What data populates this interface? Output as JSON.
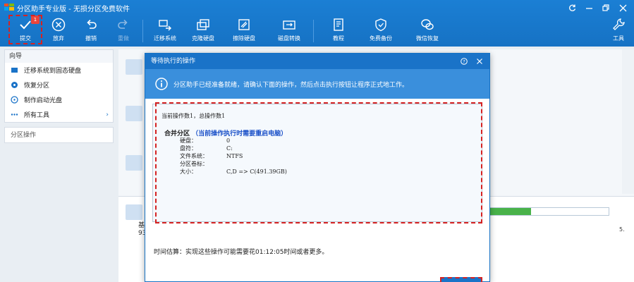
{
  "app": {
    "title": "分区助手专业版 - 无损分区免费软件"
  },
  "toolbar": {
    "commit": "提交",
    "commit_badge": "1",
    "discard": "放弃",
    "undo": "撤销",
    "redo": "重做",
    "migrate_os": "迁移系统",
    "clone_disk": "克隆硬盘",
    "wipe_disk": "擦除硬盘",
    "convert_disk": "磁盘转换",
    "tutorial": "教程",
    "free_backup": "免费备份",
    "wechat_recovery": "微信恢复",
    "tools": "工具"
  },
  "sidebar": {
    "wizard_header": "向导",
    "items": [
      {
        "label": "迁移系统到固态硬盘"
      },
      {
        "label": "恢复分区"
      },
      {
        "label": "制作启动光盘"
      },
      {
        "label": "所有工具"
      }
    ],
    "partition_ops_header": "分区操作"
  },
  "main": {
    "basic_label": "基",
    "basic_size": "93",
    "partition_fill": 0.37,
    "right_legend": [
      "5."
    ]
  },
  "dialog": {
    "title": "等待执行的操作",
    "info": "分区助手已经准备就绪，请确认下面的操作，然后点击执行按钮让程序正式地工作。",
    "ops_count": "当前操作数1，总操作数1",
    "op_title": "合并分区",
    "op_note": "（当前操作执行时需要重启电脑）",
    "rows": [
      {
        "key": "硬盘：",
        "value": "0"
      },
      {
        "key": "盘符：",
        "value": "C:"
      },
      {
        "key": "文件系统：",
        "value": "NTFS"
      },
      {
        "key": "分区卷标：",
        "value": ""
      },
      {
        "key": "大小：",
        "value": "C,D => C(491.39GB)"
      }
    ],
    "time_estimate": "时间估算：实现这些操作可能需要花01:12:05时间或者更多。"
  },
  "colors": {
    "accent": "#1a73c8",
    "highlight": "#d52222",
    "note": "#1a50c8"
  }
}
